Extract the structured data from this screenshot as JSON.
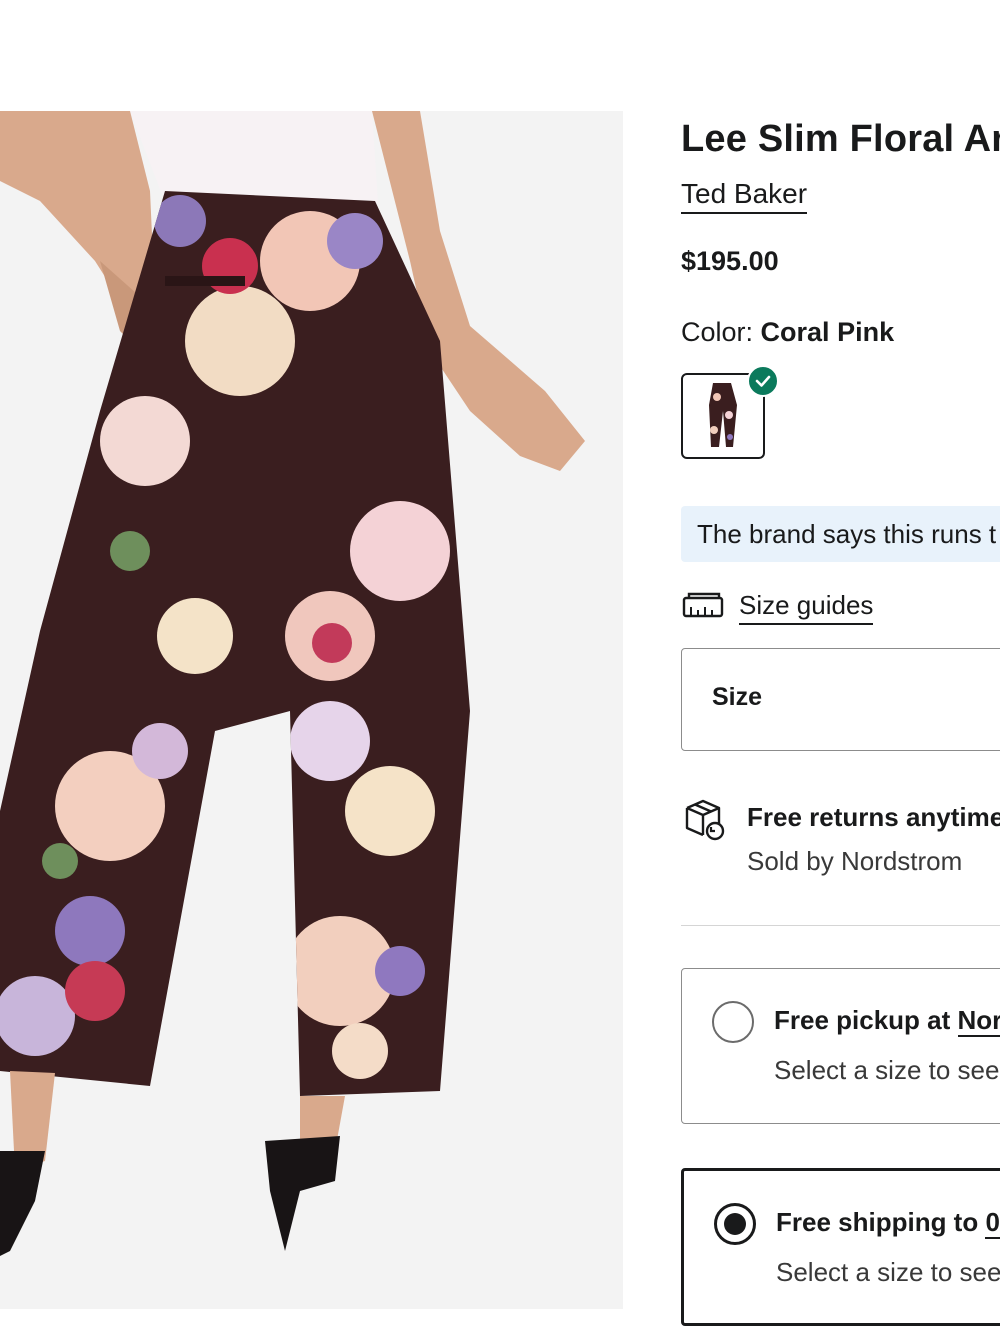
{
  "product": {
    "title": "Lee Slim Floral Ar",
    "brand": "Ted Baker",
    "price": "$195.00",
    "color_label": "Color:",
    "color_value": "Coral Pink",
    "swatch_selected": true
  },
  "fit_note": "The brand says this runs t",
  "size_guides": {
    "label": "Size guides",
    "icon": "ruler-box-icon"
  },
  "size_select": {
    "label": "Size"
  },
  "returns": {
    "icon": "box-return-icon",
    "title": "Free returns anytime",
    "sold_by": "Sold by Nordstrom"
  },
  "delivery_options": [
    {
      "title_prefix": "Free pickup at ",
      "title_link": "Nor",
      "subtitle": "Select a size to see",
      "selected": false
    },
    {
      "title_prefix": "Free shipping to ",
      "title_link": "0",
      "subtitle": "Select a size to see",
      "selected": true
    }
  ],
  "colors": {
    "accent_check": "#0b7a5c",
    "fit_note_bg": "#e8f2fb"
  }
}
